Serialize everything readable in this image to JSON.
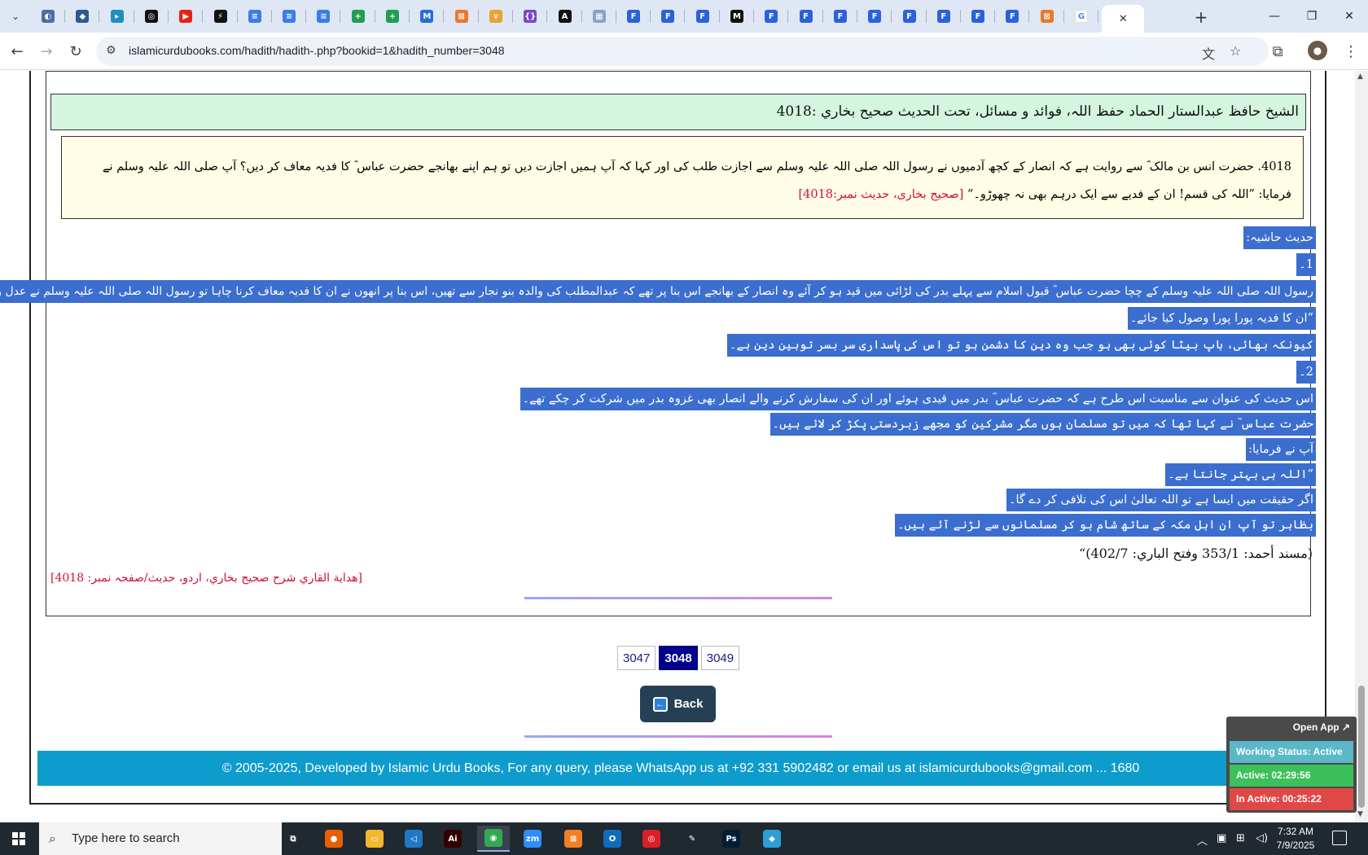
{
  "browser": {
    "url": "islamicurdubooks.com/hadith/hadith-.php?bookid=1&hadith_number=3048",
    "new_tab": "+",
    "close_tab": "✕",
    "tabs": [
      {
        "icon": "tab-favicon-1",
        "color": "#4a6fa5",
        "glyph": "◐"
      },
      {
        "icon": "tab-favicon-2",
        "color": "#2d5a8e",
        "glyph": "◆"
      },
      {
        "icon": "tab-favicon-3",
        "color": "#1f8fc0",
        "glyph": "▸"
      },
      {
        "icon": "tab-favicon-4",
        "color": "#111111",
        "glyph": "◎"
      },
      {
        "icon": "tab-favicon-youtube",
        "color": "#e62117",
        "glyph": "▶"
      },
      {
        "icon": "tab-favicon-5",
        "color": "#111111",
        "glyph": "⚡"
      },
      {
        "icon": "tab-favicon-doc",
        "color": "#3a7de8",
        "glyph": "≡"
      },
      {
        "icon": "tab-favicon-doc",
        "color": "#3a7de8",
        "glyph": "≡"
      },
      {
        "icon": "tab-favicon-doc",
        "color": "#3a7de8",
        "glyph": "≡"
      },
      {
        "icon": "tab-favicon-sheet",
        "color": "#1e9e50",
        "glyph": "+"
      },
      {
        "icon": "tab-favicon-sheet",
        "color": "#1e9e50",
        "glyph": "+"
      },
      {
        "icon": "tab-favicon-6",
        "color": "#2b6cd8",
        "glyph": "M"
      },
      {
        "icon": "tab-favicon-7",
        "color": "#e8792b",
        "glyph": "⊠"
      },
      {
        "icon": "tab-favicon-8",
        "color": "#f0a030",
        "glyph": "∨"
      },
      {
        "icon": "tab-favicon-9",
        "color": "#7a45c8",
        "glyph": "{}"
      },
      {
        "icon": "tab-favicon-10",
        "color": "#111111",
        "glyph": "A"
      },
      {
        "icon": "tab-favicon-11",
        "color": "#8aa0c8",
        "glyph": "▦"
      },
      {
        "icon": "tab-favicon-12",
        "color": "#2b62d8",
        "glyph": "F"
      },
      {
        "icon": "tab-favicon-12",
        "color": "#2b62d8",
        "glyph": "F"
      },
      {
        "icon": "tab-favicon-12",
        "color": "#2b62d8",
        "glyph": "F"
      },
      {
        "icon": "tab-favicon-13",
        "color": "#111111",
        "glyph": "M"
      },
      {
        "icon": "tab-favicon-12",
        "color": "#2b62d8",
        "glyph": "F"
      },
      {
        "icon": "tab-favicon-12",
        "color": "#2b62d8",
        "glyph": "F"
      },
      {
        "icon": "tab-favicon-12",
        "color": "#2b62d8",
        "glyph": "F"
      },
      {
        "icon": "tab-favicon-12",
        "color": "#2b62d8",
        "glyph": "F"
      },
      {
        "icon": "tab-favicon-12",
        "color": "#2b62d8",
        "glyph": "F"
      },
      {
        "icon": "tab-favicon-12",
        "color": "#2b62d8",
        "glyph": "F"
      },
      {
        "icon": "tab-favicon-12",
        "color": "#2b62d8",
        "glyph": "F"
      },
      {
        "icon": "tab-favicon-12",
        "color": "#2b62d8",
        "glyph": "F"
      },
      {
        "icon": "tab-favicon-7",
        "color": "#e8792b",
        "glyph": "⊠"
      },
      {
        "icon": "tab-favicon-google",
        "color": "#ffffff",
        "glyph": "G"
      }
    ]
  },
  "page": {
    "header": "الشیخ حافظ عبدالستار الحماد حفظ اللہ، فوائد و مسائل، تحت الحديث صحيح بخاري :4018",
    "hadith_text": "4018. حضرت انس بن مالک ؓ سے روایت ہے کہ انصار کے کچھ آدمیوں نے رسول اللہ صلی اللہ علیہ وسلم سے اجازت طلب کی اور کہا کہ آپ ہمیں اجازت دیں تو ہم اپنے بھانجے حضرت عباس ؓ کا فدیہ معاف کر دیں؟ آپ صلی اللہ علیہ وسلم نے فرمایا: ”اللہ کی قسم! ان کے فدیے سے ایک درہم بھی نہ چھوڑو۔“",
    "hadith_ref": "[صحیح بخاری، حدیث نمبر:4018]",
    "commentary": [
      "حدیث حاشیہ:",
      "1۔",
      "رسول اللہ صلی اللہ علیہ وسلم کے چچا حضرت عباس ؓ قبول اسلام سے پہلے بدر کی لڑائی میں قید ہو کر آئے وہ انصار کے بھانجے اس بنا پر تھے کہ عبدالمطلب کی والدہ بنو نجار سے تھیں، اس بنا پر انھوں نے ان کا فدیہ معاف کرنا چاہا تو رسول اللہ صلی اللہ علیہ وسلم نے عدل و انصاف کے تقاضوں کو پورا کرتے ہوئے فرمایا:",
      "”ان کا فدیہ پورا پورا وصول کیا جائے۔",
      "کیونکہ بھائی، باپ بیٹا کوئی بھی ہو جب وہ دین کا دشمن ہو تو اس کی پاسداری سر بسر توہین دین ہے۔",
      "2۔",
      "اس حدیث کی عنوان سے مناسبت اس طرح ہے کہ حضرت عباس ؓ بدر میں قیدی ہوئے اور ان کی سفارش کرنے والے انصار بھی غزوہ بدر میں شرکت کر چکے تھے۔",
      "حضرت عباس ؓ نے کہا تھا کہ میں تو مسلمان ہوں مگر مشرکین کو مجھے زبردستی پکڑ کر لائے ہیں۔",
      "آپ نے فرمایا:",
      "”اللہ ہی بہتر جانتا ہے۔",
      "اگر حقیقت میں ایسا ہے تو اللہ تعالیٰ اس کی تلافی کر دے گا۔",
      "بظاہر تو آپ ان اہل مکہ کے ساتھ شام ہو کر مسلمانوں سے لڑنے آئے ہیں۔"
    ],
    "footnote": "(مسند أحمد: 353/1 وفتح الباري: 402/7)“",
    "book_ref": "[هداية القاري شرح صحيح بخاري، اردو، حديث/صفحہ نمبر: 4018]",
    "pagination": [
      {
        "label": "3047",
        "current": false
      },
      {
        "label": "3048",
        "current": true
      },
      {
        "label": "3049",
        "current": false
      }
    ],
    "back_label": "Back",
    "footer": "© 2005-2025, Developed by Islamic Urdu Books, For any query, please WhatsApp us at +92 331 5902482 or email us at islamicurdubooks@gmail.com ... 1680"
  },
  "widget": {
    "open_app": "Open App ↗",
    "working_status": "Working Status: Active",
    "active": "Active: 02:29:56",
    "inactive": "In Active: 00:25:22",
    "colors": {
      "status": "#5ab8c8",
      "active": "#3cc05a",
      "inactive": "#e04848"
    }
  },
  "taskbar": {
    "search_placeholder": "Type here to search",
    "time": "7:32 AM",
    "date": "7/9/2025",
    "apps": [
      {
        "name": "task-view-icon",
        "color": "#202830",
        "glyph": "⧉"
      },
      {
        "name": "firefox-icon",
        "color": "#e66000",
        "glyph": "●"
      },
      {
        "name": "file-explorer-icon",
        "color": "#f2b72e",
        "glyph": "▭"
      },
      {
        "name": "vscode-icon",
        "color": "#2178c8",
        "glyph": "◁"
      },
      {
        "name": "illustrator-icon",
        "color": "#330000",
        "glyph": "Ai"
      },
      {
        "name": "chrome-icon",
        "color": "#34a853",
        "glyph": "◉"
      },
      {
        "name": "zoom-icon",
        "color": "#2d8cff",
        "glyph": "zm"
      },
      {
        "name": "xampp-icon",
        "color": "#f47e23",
        "glyph": "⊠"
      },
      {
        "name": "outlook-icon",
        "color": "#0f6cbd",
        "glyph": "O"
      },
      {
        "name": "creative-cloud-icon",
        "color": "#da1f26",
        "glyph": "◎"
      },
      {
        "name": "pen-tool-icon",
        "color": "#202830",
        "glyph": "✎"
      },
      {
        "name": "photoshop-icon",
        "color": "#001e36",
        "glyph": "Ps"
      },
      {
        "name": "app-icon",
        "color": "#2a9fd6",
        "glyph": "◆"
      }
    ]
  }
}
